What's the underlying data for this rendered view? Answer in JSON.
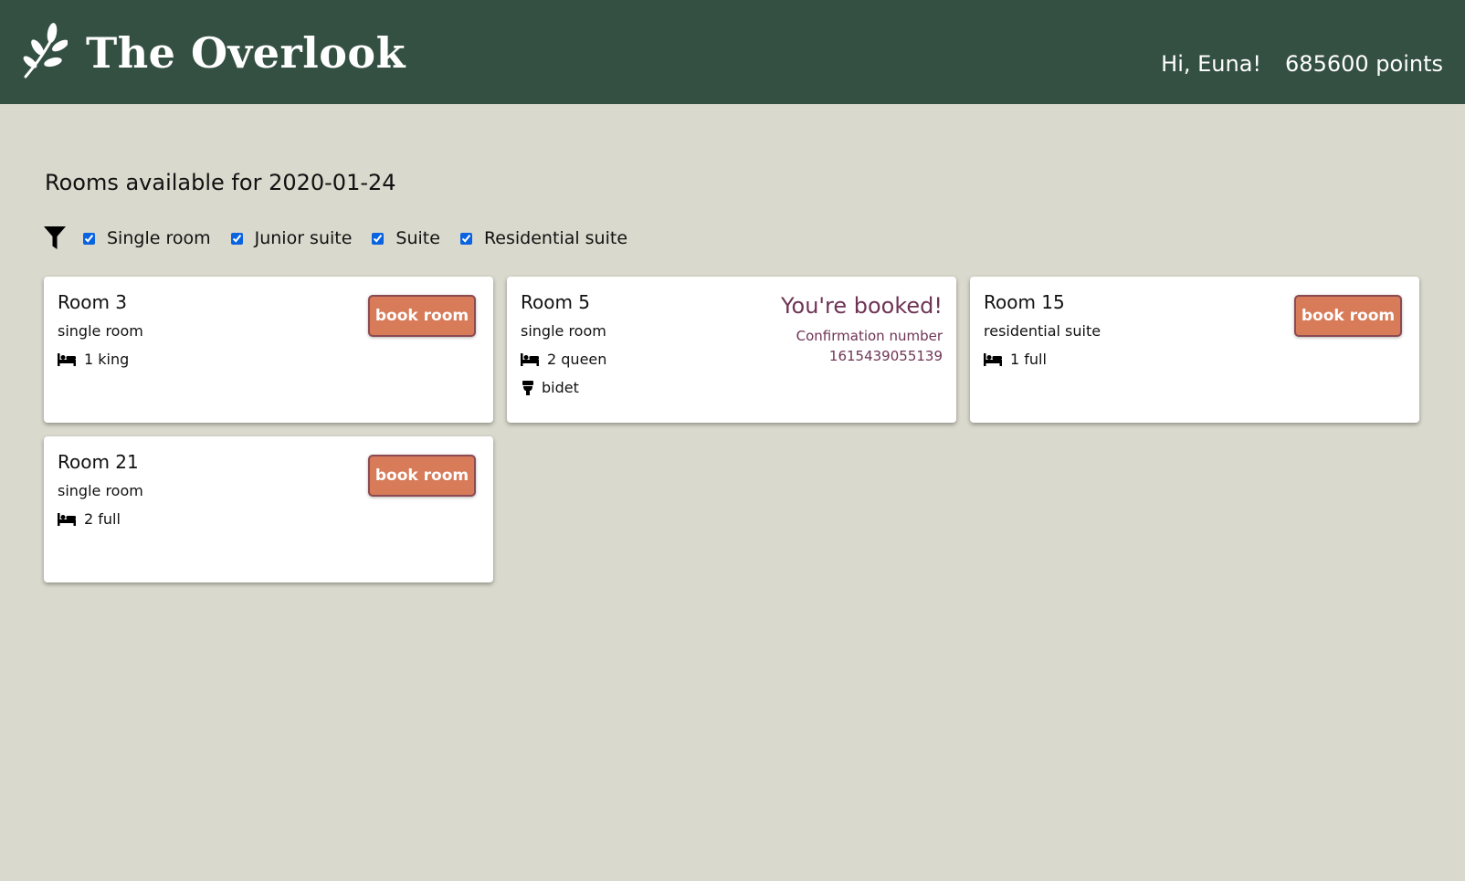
{
  "header": {
    "brand": "The Overlook",
    "greeting": "Hi, Euna!",
    "points": "685600 points",
    "logo_icon": "leaf-branch-icon"
  },
  "main": {
    "heading": "Rooms available for 2020-01-24",
    "filter_icon": "funnel-icon",
    "filters": [
      {
        "label": "Single room",
        "checked": true
      },
      {
        "label": "Junior suite",
        "checked": true
      },
      {
        "label": "Suite",
        "checked": true
      },
      {
        "label": "Residential suite",
        "checked": true
      }
    ],
    "rooms": [
      {
        "number": "Room 3",
        "type": "single room",
        "beds": "1 king",
        "book_label": "book room"
      },
      {
        "number": "Room 5",
        "type": "single room",
        "beds": "2 queen",
        "extra": "bidet",
        "booked_title": "You're booked!",
        "confirmation_label": "Confirmation number",
        "confirmation_number": "1615439055139"
      },
      {
        "number": "Room 15",
        "type": "residential suite",
        "beds": "1 full",
        "book_label": "book room"
      },
      {
        "number": "Room 21",
        "type": "single room",
        "beds": "2 full",
        "book_label": "book room"
      }
    ]
  },
  "colors": {
    "header_bg": "#345043",
    "page_bg": "#dad9cd",
    "button_bg": "#d77b59",
    "booked_text": "#6e3455"
  }
}
